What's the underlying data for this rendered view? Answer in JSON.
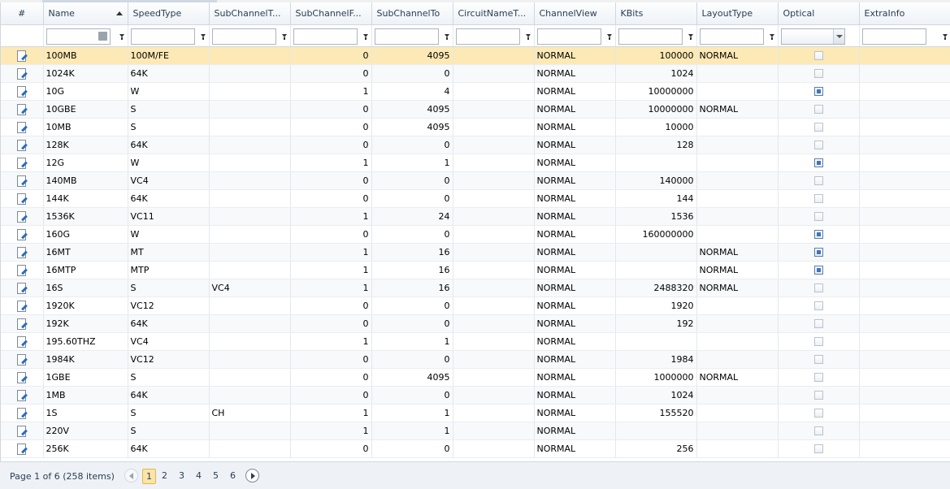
{
  "columns": [
    "#",
    "Name",
    "SpeedType",
    "SubChannelT...",
    "SubChannelF...",
    "SubChannelTo",
    "CircuitNameT...",
    "ChannelView",
    "KBits",
    "LayoutType",
    "Optical",
    "ExtraInfo"
  ],
  "rows": [
    {
      "name": "100MB",
      "speed": "100M/FE",
      "subT": "",
      "subF": "0",
      "subTo": "4095",
      "circ": "",
      "view": "NORMAL",
      "kbits": "100000",
      "layout": "NORMAL",
      "optical": false,
      "extra": ""
    },
    {
      "name": "1024K",
      "speed": "64K",
      "subT": "",
      "subF": "0",
      "subTo": "0",
      "circ": "",
      "view": "NORMAL",
      "kbits": "1024",
      "layout": "",
      "optical": false,
      "extra": ""
    },
    {
      "name": "10G",
      "speed": "W",
      "subT": "",
      "subF": "1",
      "subTo": "4",
      "circ": "",
      "view": "NORMAL",
      "kbits": "10000000",
      "layout": "",
      "optical": true,
      "extra": ""
    },
    {
      "name": "10GBE",
      "speed": "S",
      "subT": "",
      "subF": "0",
      "subTo": "4095",
      "circ": "",
      "view": "NORMAL",
      "kbits": "10000000",
      "layout": "NORMAL",
      "optical": false,
      "extra": ""
    },
    {
      "name": "10MB",
      "speed": "S",
      "subT": "",
      "subF": "0",
      "subTo": "4095",
      "circ": "",
      "view": "NORMAL",
      "kbits": "10000",
      "layout": "",
      "optical": false,
      "extra": ""
    },
    {
      "name": "128K",
      "speed": "64K",
      "subT": "",
      "subF": "0",
      "subTo": "0",
      "circ": "",
      "view": "NORMAL",
      "kbits": "128",
      "layout": "",
      "optical": false,
      "extra": ""
    },
    {
      "name": "12G",
      "speed": "W",
      "subT": "",
      "subF": "1",
      "subTo": "1",
      "circ": "",
      "view": "NORMAL",
      "kbits": "",
      "layout": "",
      "optical": true,
      "extra": ""
    },
    {
      "name": "140MB",
      "speed": "VC4",
      "subT": "",
      "subF": "0",
      "subTo": "0",
      "circ": "",
      "view": "NORMAL",
      "kbits": "140000",
      "layout": "",
      "optical": false,
      "extra": ""
    },
    {
      "name": "144K",
      "speed": "64K",
      "subT": "",
      "subF": "0",
      "subTo": "0",
      "circ": "",
      "view": "NORMAL",
      "kbits": "144",
      "layout": "",
      "optical": false,
      "extra": ""
    },
    {
      "name": "1536K",
      "speed": "VC11",
      "subT": "",
      "subF": "1",
      "subTo": "24",
      "circ": "",
      "view": "NORMAL",
      "kbits": "1536",
      "layout": "",
      "optical": false,
      "extra": ""
    },
    {
      "name": "160G",
      "speed": "W",
      "subT": "",
      "subF": "0",
      "subTo": "0",
      "circ": "",
      "view": "NORMAL",
      "kbits": "160000000",
      "layout": "",
      "optical": true,
      "extra": ""
    },
    {
      "name": "16MT",
      "speed": "MT",
      "subT": "",
      "subF": "1",
      "subTo": "16",
      "circ": "",
      "view": "NORMAL",
      "kbits": "",
      "layout": "NORMAL",
      "optical": true,
      "extra": ""
    },
    {
      "name": "16MTP",
      "speed": "MTP",
      "subT": "",
      "subF": "1",
      "subTo": "16",
      "circ": "",
      "view": "NORMAL",
      "kbits": "",
      "layout": "NORMAL",
      "optical": true,
      "extra": ""
    },
    {
      "name": "16S",
      "speed": "S",
      "subT": "VC4",
      "subF": "1",
      "subTo": "16",
      "circ": "",
      "view": "NORMAL",
      "kbits": "2488320",
      "layout": "NORMAL",
      "optical": false,
      "extra": ""
    },
    {
      "name": "1920K",
      "speed": "VC12",
      "subT": "",
      "subF": "0",
      "subTo": "0",
      "circ": "",
      "view": "NORMAL",
      "kbits": "1920",
      "layout": "",
      "optical": false,
      "extra": ""
    },
    {
      "name": "192K",
      "speed": "64K",
      "subT": "",
      "subF": "0",
      "subTo": "0",
      "circ": "",
      "view": "NORMAL",
      "kbits": "192",
      "layout": "",
      "optical": false,
      "extra": ""
    },
    {
      "name": "195.60THZ",
      "speed": "VC4",
      "subT": "",
      "subF": "1",
      "subTo": "1",
      "circ": "",
      "view": "NORMAL",
      "kbits": "",
      "layout": "",
      "optical": false,
      "extra": ""
    },
    {
      "name": "1984K",
      "speed": "VC12",
      "subT": "",
      "subF": "0",
      "subTo": "0",
      "circ": "",
      "view": "NORMAL",
      "kbits": "1984",
      "layout": "",
      "optical": false,
      "extra": ""
    },
    {
      "name": "1GBE",
      "speed": "S",
      "subT": "",
      "subF": "0",
      "subTo": "4095",
      "circ": "",
      "view": "NORMAL",
      "kbits": "1000000",
      "layout": "NORMAL",
      "optical": false,
      "extra": ""
    },
    {
      "name": "1MB",
      "speed": "64K",
      "subT": "",
      "subF": "0",
      "subTo": "0",
      "circ": "",
      "view": "NORMAL",
      "kbits": "1024",
      "layout": "",
      "optical": false,
      "extra": ""
    },
    {
      "name": "1S",
      "speed": "S",
      "subT": "CH",
      "subF": "1",
      "subTo": "1",
      "circ": "",
      "view": "NORMAL",
      "kbits": "155520",
      "layout": "",
      "optical": false,
      "extra": ""
    },
    {
      "name": "220V",
      "speed": "S",
      "subT": "",
      "subF": "1",
      "subTo": "1",
      "circ": "",
      "view": "NORMAL",
      "kbits": "",
      "layout": "",
      "optical": false,
      "extra": ""
    },
    {
      "name": "256K",
      "speed": "64K",
      "subT": "",
      "subF": "0",
      "subTo": "0",
      "circ": "",
      "view": "NORMAL",
      "kbits": "256",
      "layout": "",
      "optical": false,
      "extra": ""
    }
  ],
  "pager": {
    "info": "Page 1 of 6 (258 items)",
    "pages": [
      "1",
      "2",
      "3",
      "4",
      "5",
      "6"
    ],
    "current": "1"
  },
  "colors": {
    "active_row": "#fde9b5",
    "accent": "#3d75bf"
  }
}
